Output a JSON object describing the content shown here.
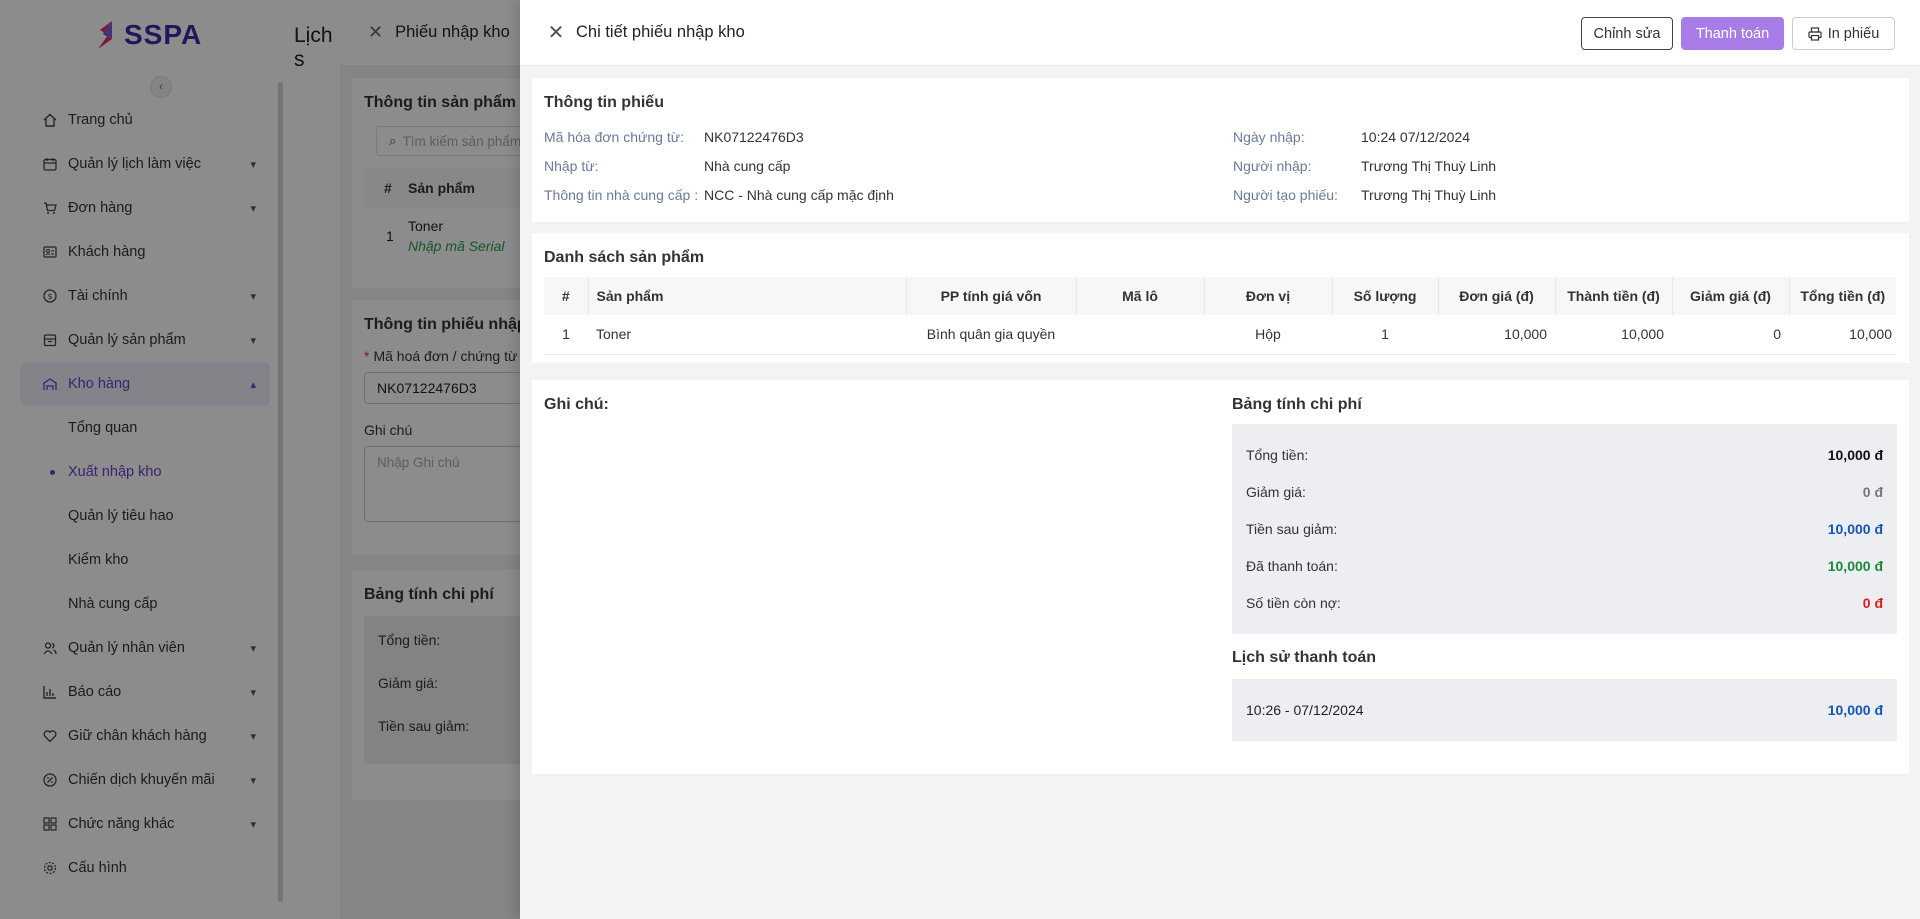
{
  "app": {
    "logo_text": "SSPA",
    "page_title": "Lịch s",
    "brand_color": "#3b2aa8",
    "accent_color": "#a77ce6"
  },
  "sidebar": {
    "items": [
      {
        "label": "Trang chủ",
        "icon": "home-icon",
        "has_children": false
      },
      {
        "label": "Quản lý lịch làm việc",
        "icon": "calendar-icon",
        "has_children": true
      },
      {
        "label": "Đơn hàng",
        "icon": "cart-icon",
        "has_children": true
      },
      {
        "label": "Khách hàng",
        "icon": "contact-card-icon",
        "has_children": false
      },
      {
        "label": "Tài chính",
        "icon": "coin-icon",
        "has_children": true
      },
      {
        "label": "Quản lý sản phẩm",
        "icon": "box-icon",
        "has_children": true
      },
      {
        "label": "Kho hàng",
        "icon": "warehouse-icon",
        "has_children": true,
        "active": true
      }
    ],
    "warehouse_sub": [
      {
        "label": "Tổng quan"
      },
      {
        "label": "Xuất nhập kho",
        "active": true
      },
      {
        "label": "Quản lý tiêu hao"
      },
      {
        "label": "Kiểm kho"
      },
      {
        "label": "Nhà cung cấp"
      }
    ],
    "items_after": [
      {
        "label": "Quản lý nhân viên",
        "icon": "users-icon",
        "has_children": true
      },
      {
        "label": "Báo cáo",
        "icon": "bar-chart-icon",
        "has_children": true
      },
      {
        "label": "Giữ chân khách hàng",
        "icon": "heart-icon",
        "has_children": true
      },
      {
        "label": "Chiến dịch khuyến mãi",
        "icon": "discount-icon",
        "has_children": true
      },
      {
        "label": "Chức năng khác",
        "icon": "grid-icon",
        "has_children": true
      },
      {
        "label": "Cấu hình",
        "icon": "gear-icon",
        "has_children": false
      }
    ]
  },
  "import_drawer": {
    "title": "Phiếu nhập kho",
    "product_info_title": "Thông tin sản phẩm",
    "search_placeholder": "Tìm kiếm sản phẩm",
    "table_headers": [
      "#",
      "Sản phẩm"
    ],
    "row": {
      "index": "1",
      "name": "Toner",
      "serial_link": "Nhập mã Serial"
    },
    "form_title": "Thông tin phiếu nhập",
    "invoice_label": "Mã hoá đơn / chứng từ",
    "invoice_value": "NK07122476D3",
    "note_label": "Ghi chú",
    "note_placeholder": "Nhập Ghi chú",
    "cost_title": "Bảng tính chi phí",
    "cost_lines": [
      "Tổng tiền:",
      "Giảm giá:",
      "Tiền sau giảm:"
    ]
  },
  "detail": {
    "title": "Chi tiết phiếu nhập kho",
    "buttons": {
      "edit": "Chỉnh sửa",
      "pay": "Thanh toán",
      "print": "In phiếu"
    },
    "info": {
      "title": "Thông tin phiếu",
      "invoice_label": "Mã hóa đơn chứng từ:",
      "invoice_value": "NK07122476D3",
      "source_label": "Nhập từ:",
      "source_value": "Nhà cung cấp",
      "supplier_label": "Thông tin nhà cung cấp :",
      "supplier_value": "NCC - Nhà cung cấp mặc định",
      "date_label": "Ngày nhập:",
      "date_value": "10:24 07/12/2024",
      "importer_label": "Người nhập:",
      "importer_value": "Trương Thị Thuỳ Linh",
      "creator_label": "Người tạo phiếu:",
      "creator_value": "Trương Thị Thuỳ Linh"
    },
    "products": {
      "title": "Danh sách sản phẩm",
      "headers": [
        "#",
        "Sản phẩm",
        "PP tính giá vốn",
        "Mã lô",
        "Đơn vị",
        "Số lượng",
        "Đơn giá (đ)",
        "Thành tiền (đ)",
        "Giảm giá (đ)",
        "Tổng tiền (đ)"
      ],
      "rows": [
        {
          "index": "1",
          "product": "Toner",
          "cost_method": "Bình quân gia quyền",
          "lot": "",
          "unit": "Hộp",
          "qty": "1",
          "unit_price": "10,000",
          "amount": "10,000",
          "discount": "0",
          "total": "10,000"
        }
      ]
    },
    "note_title": "Ghi chú:",
    "cost": {
      "title": "Bảng tính chi phí",
      "lines": [
        {
          "label": "Tổng tiền:",
          "value": "10,000 đ",
          "color": "#111111"
        },
        {
          "label": "Giảm giá:",
          "value": "0 đ",
          "color": "#777777"
        },
        {
          "label": "Tiền sau giảm:",
          "value": "10,000 đ",
          "color": "#1456b8"
        },
        {
          "label": "Đã thanh toán:",
          "value": "10,000 đ",
          "color": "#1a8a3a"
        },
        {
          "label": "Số tiền còn nợ:",
          "value": "0 đ",
          "color": "#e01b1b"
        }
      ]
    },
    "history": {
      "title": "Lịch sử thanh toán",
      "time": "10:26 - 07/12/2024",
      "amount": "10,000 đ"
    }
  }
}
